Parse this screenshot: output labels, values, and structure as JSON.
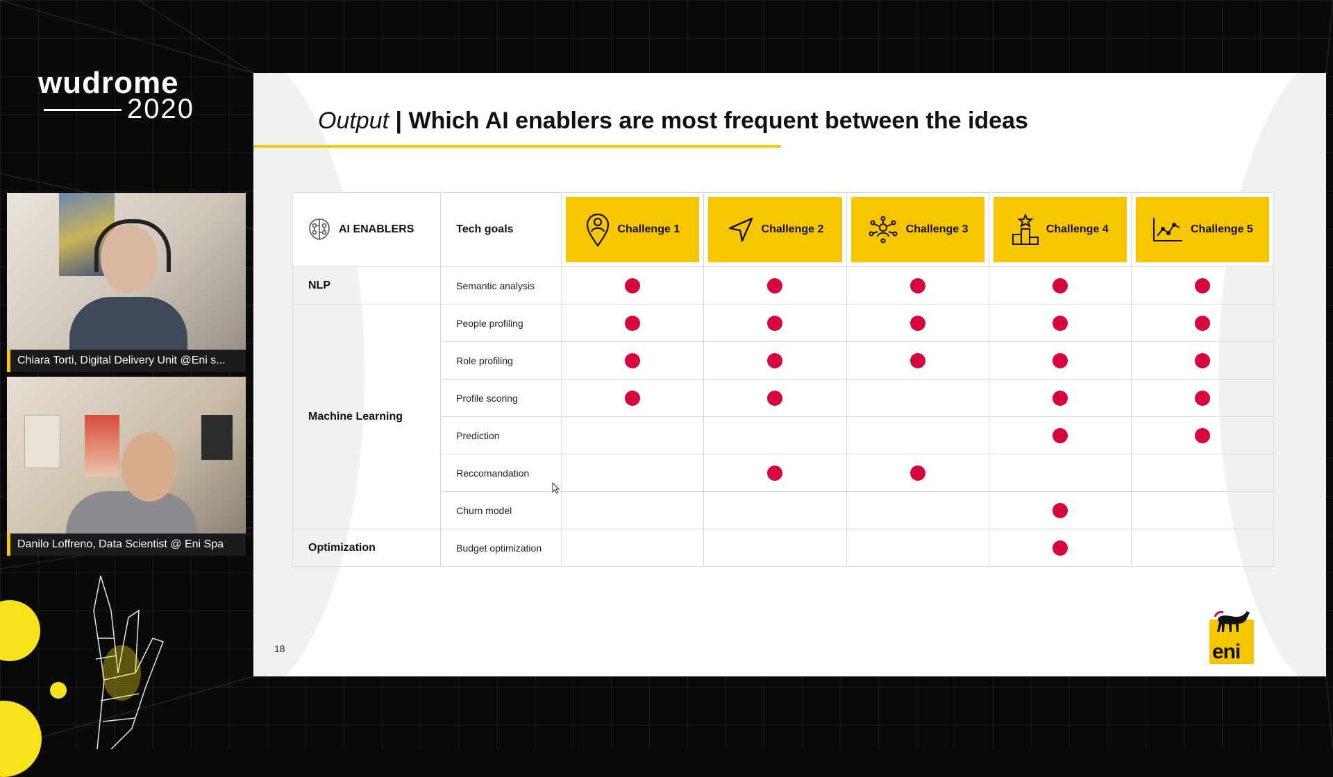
{
  "event": {
    "name": "wudrome",
    "year": "2020"
  },
  "speakers": [
    {
      "caption": "Chiara Torti, Digital Delivery Unit @Eni s..."
    },
    {
      "caption": "Danilo Loffreno, Data Scientist @ Eni Spa"
    }
  ],
  "slide": {
    "title_italic": "Output",
    "title_separator": "|",
    "title_bold": "Which AI enablers are most frequent between the ideas",
    "page_number": "18",
    "logo_text": "eni",
    "table": {
      "enablers_header": "AI ENABLERS",
      "goals_header": "Tech goals",
      "challenges": [
        {
          "label": "Challenge 1",
          "icon": "location-person-icon"
        },
        {
          "label": "Challenge 2",
          "icon": "navigation-arrow-icon"
        },
        {
          "label": "Challenge 3",
          "icon": "network-people-icon"
        },
        {
          "label": "Challenge 4",
          "icon": "podium-star-icon"
        },
        {
          "label": "Challenge 5",
          "icon": "line-chart-icon"
        }
      ],
      "groups": [
        {
          "enabler": "NLP",
          "rows": [
            {
              "goal": "Semantic analysis",
              "marks": [
                true,
                true,
                true,
                true,
                true
              ]
            }
          ]
        },
        {
          "enabler": "Machine Learning",
          "rows": [
            {
              "goal": "People profiling",
              "marks": [
                true,
                true,
                true,
                true,
                true
              ]
            },
            {
              "goal": "Role profiling",
              "marks": [
                true,
                true,
                true,
                true,
                true
              ]
            },
            {
              "goal": "Profile scoring",
              "marks": [
                true,
                true,
                false,
                true,
                true
              ]
            },
            {
              "goal": "Prediction",
              "marks": [
                false,
                false,
                false,
                true,
                true
              ]
            },
            {
              "goal": "Reccomandation",
              "marks": [
                false,
                true,
                true,
                false,
                false
              ]
            },
            {
              "goal": "Churn model",
              "marks": [
                false,
                false,
                false,
                true,
                false
              ]
            }
          ]
        },
        {
          "enabler": "Optimization",
          "rows": [
            {
              "goal": "Budget optimization",
              "marks": [
                false,
                false,
                false,
                true,
                false
              ]
            }
          ]
        }
      ]
    }
  },
  "colors": {
    "accent_yellow": "#f7c600",
    "mark_red": "#d6063c",
    "background": "#0a0a0a",
    "deco_yellow": "#f7e21b"
  }
}
